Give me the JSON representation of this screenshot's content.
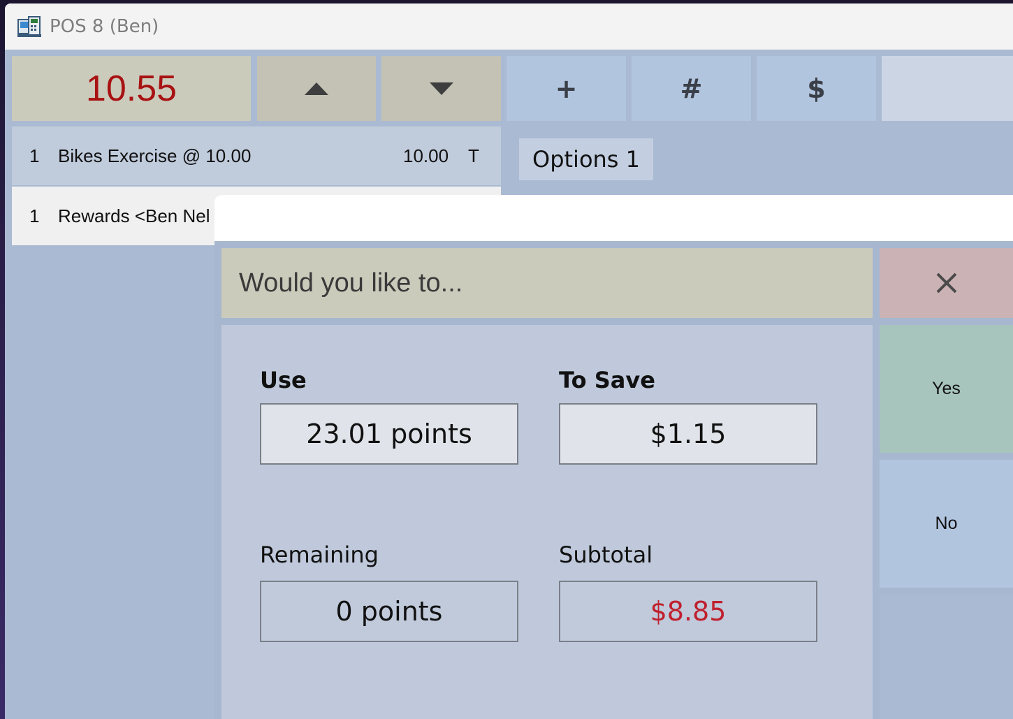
{
  "window": {
    "title": "POS 8  (Ben)"
  },
  "toolbar": {
    "total": "10.55",
    "plus_label": "+",
    "hash_label": "#",
    "dollar_label": "$"
  },
  "order": {
    "rows": [
      {
        "qty": "1",
        "description": "Bikes Exercise @ 10.00",
        "price": "10.00",
        "tax": "T"
      },
      {
        "qty": "1",
        "description": "Rewards <Ben Nel",
        "price": "",
        "tax": ""
      }
    ]
  },
  "options_tab": {
    "label": "Options 1"
  },
  "dialog": {
    "header": "Would you like to...",
    "use_label": "Use",
    "use_value": "23.01 points",
    "save_label": "To Save",
    "save_value": "$1.15",
    "remaining_label": "Remaining",
    "remaining_value": "0 points",
    "subtotal_label": "Subtotal",
    "subtotal_value": "$8.85",
    "yes_label": "Yes",
    "no_label": "No"
  },
  "colors": {
    "total_text": "#a81212",
    "subtotal_text": "#c0202e",
    "yes_bg": "#a8c5bd",
    "cancel_bg": "#cbb2b5"
  }
}
